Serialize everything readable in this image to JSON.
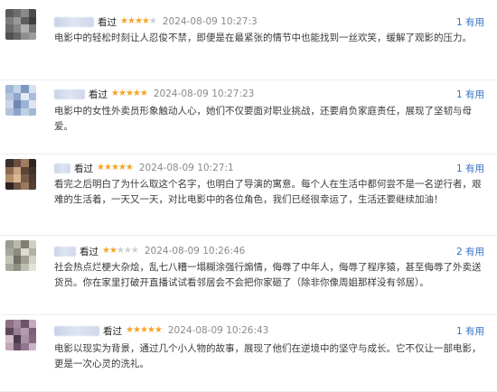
{
  "reviews": [
    {
      "seen": "看过",
      "rating": 4,
      "time": "2024-08-09 10:27:3",
      "useful": "1 有用",
      "text": "电影中的轻松时刻让人忍俊不禁，即便是在最紧张的情节中也能找到一丝欢笑，缓解了观影的压力。",
      "avatar_colors": [
        "#5b5b5b",
        "#6d6d6d",
        "#8a8a8a",
        "#4c4c4c",
        "#7c7c7c",
        "#9a9a9a",
        "#5e5e5e",
        "#3f3f3f",
        "#6a6a6a",
        "#848484",
        "#b0b0b0",
        "#777777",
        "#505050",
        "#666666",
        "#8e8e8e",
        "#9c9c9c"
      ]
    },
    {
      "seen": "看过",
      "rating": 5,
      "time": "2024-08-09 10:27:23",
      "useful": "1 有用",
      "text": "电影中的女性外卖员形象触动人心，她们不仅要面对职业挑战，还要肩负家庭责任，展现了坚韧与母爱。",
      "avatar_colors": [
        "#9fb7d6",
        "#c3d2e6",
        "#7f98bf",
        "#d8e1ee",
        "#b6c5dd",
        "#8fa7cc",
        "#e4eaf3",
        "#a8bcd8",
        "#c9d5e8",
        "#7088b3",
        "#9db2d3",
        "#dfe6f0",
        "#b1c2dc",
        "#8ca4c9",
        "#c0cfe4",
        "#a2b7d5"
      ]
    },
    {
      "seen": "看过",
      "rating": 5,
      "time": "2024-08-09 10:27:1",
      "useful": "1 有用",
      "text": "看完之后明白了为什么取这个名字，也明白了导演的寓意。每个人在生活中都何尝不是一名逆行者，艰难的生活着，一天又一天，对比电影中的各位角色，我们已经很幸运了，生活还要继续加油！",
      "avatar_colors": [
        "#3a2f2a",
        "#6b4f3f",
        "#a07d5f",
        "#2e2622",
        "#8a6a52",
        "#c9a37f",
        "#5a4436",
        "#3f332c",
        "#b38c6a",
        "#d9b896",
        "#7a5c47",
        "#4a3a30",
        "#2b2320",
        "#6f5544",
        "#9b7a5e",
        "#553f33"
      ]
    },
    {
      "seen": "看过",
      "rating": 2,
      "time": "2024-08-09 10:26:46",
      "useful": "2 有用",
      "text": "社会热点烂梗大杂烩，乱七八糟一塌糊涂强行煽情，侮辱了中年人，侮辱了程序猿，甚至侮辱了外卖送货员。你在家里打破开直播试试看邻居会不会把你家砸了（除非你像周姐那样没有邻居）。",
      "avatar_colors": [
        "#9a9a8e",
        "#b8b7aa",
        "#7d7d73",
        "#cfcfc4",
        "#a6a69a",
        "#8c8c80",
        "#dcdcd2",
        "#b0b0a3",
        "#c4c4b8",
        "#6f6f66",
        "#9e9e92",
        "#d2d2c8",
        "#a9a99d",
        "#8f8f84",
        "#bdbdb1",
        "#e2e2da"
      ]
    },
    {
      "seen": "看过",
      "rating": 5,
      "time": "2024-08-09 10:26:43",
      "useful": "1 有用",
      "text": "电影以现实为背景，通过几个小人物的故事，展现了他们在逆境中的坚守与成长。它不仅让一部电影，更是一次心灵的洗礼。",
      "avatar_colors": [
        "#8c6f86",
        "#a58ba0",
        "#6f5469",
        "#c3aabd",
        "#5d4758",
        "#9b7f95",
        "#b59bb0",
        "#7d6277",
        "#d0bdcb",
        "#4e3b4a",
        "#a890a3",
        "#86697f",
        "#bfa6b9",
        "#6a5064",
        "#937791",
        "#c9b3c4"
      ]
    }
  ]
}
